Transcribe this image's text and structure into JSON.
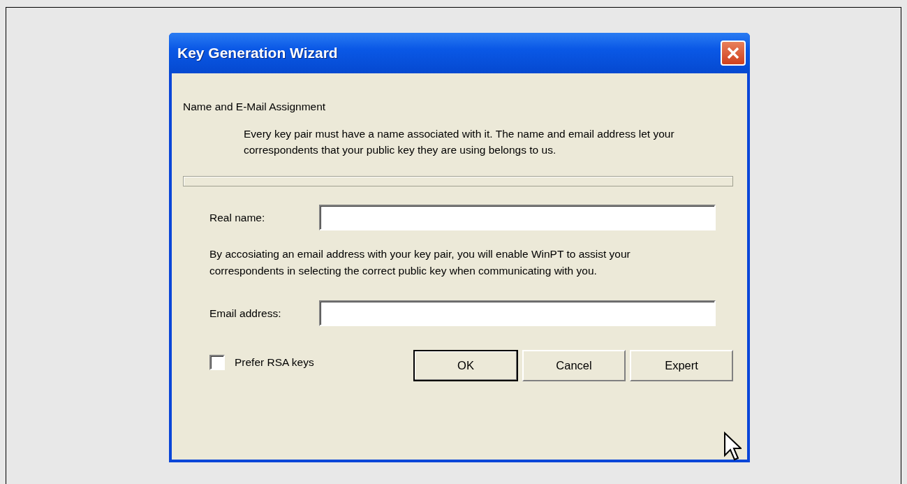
{
  "window": {
    "title": "Key Generation Wizard"
  },
  "heading": "Name and E-Mail Assignment",
  "description": "Every key pair must have a name associated with it. The name and email address let your correspondents that your public key they are using belongs to us.",
  "fields": [
    {
      "label": "Real name:"
    },
    {
      "label": "Email address:"
    }
  ],
  "note": "By accosiating an email address with your key pair, you will enable WinPT to assist your correspondents in selecting the correct public key when communicating with you.",
  "checkbox": {
    "label": "Prefer RSA keys",
    "checked": false
  },
  "buttons": [
    {
      "label": "OK",
      "default": true
    },
    {
      "label": "Cancel",
      "default": false
    },
    {
      "label": "Expert",
      "default": false
    }
  ]
}
